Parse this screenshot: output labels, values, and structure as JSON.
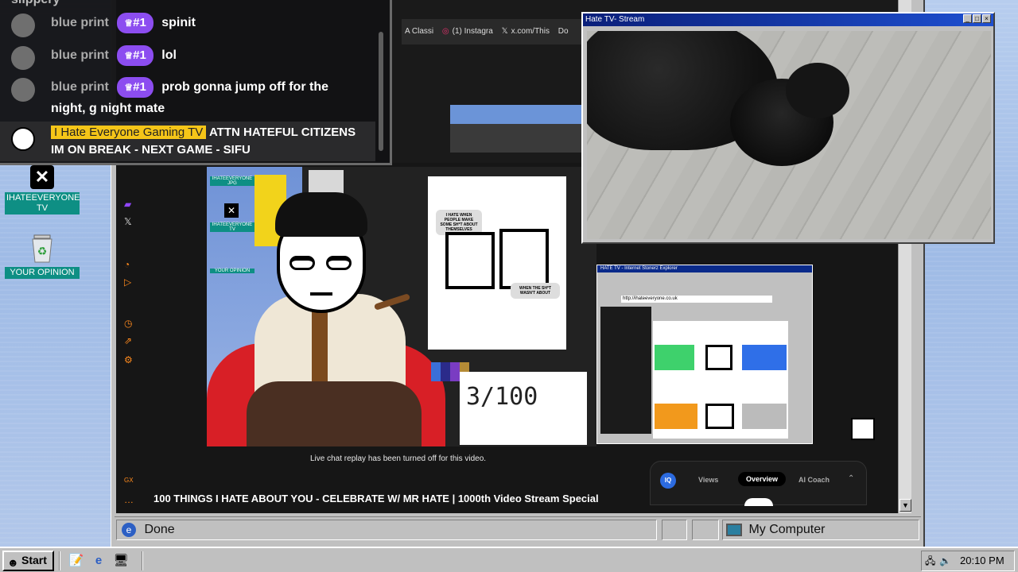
{
  "chat": {
    "partial_top": "slippery",
    "messages": [
      {
        "author": "blue print",
        "badge": "#1",
        "text": "spinit"
      },
      {
        "author": "blue print",
        "badge": "#1",
        "text": "lol"
      },
      {
        "author": "blue print",
        "badge": "#1",
        "text": "prob gonna jump off for the night, g night mate"
      }
    ],
    "pinned": {
      "author": "I Hate Everyone Gaming TV",
      "text": "ATTN HATEFUL CITIZENS IM ON BREAK - NEXT GAME - SIFU"
    }
  },
  "desktop_icons": [
    {
      "label": "IHATEEVERYONE TV",
      "icon": "x-logo-icon"
    },
    {
      "label": "YOUR OPINION",
      "icon": "recycle-bin-icon"
    }
  ],
  "browser_tabs": [
    "A Classi",
    "(1) Instagra",
    "x.com/This",
    "Do"
  ],
  "stream_window": {
    "title": "Hate TV- Stream",
    "buttons": [
      "_",
      "□",
      "×"
    ]
  },
  "video": {
    "mini_icons": [
      "IHATEEVERYONE JPG",
      "IHATEEVERYONE TV",
      "YOUR OPINION"
    ],
    "speech_top": "I HATE WHEN PEOPLE MAKE SOME SH*T ABOUT THEMSELVES",
    "speech_bottom": "WHEN THE SH*T WASN'T ABOUT",
    "counter": "3/100",
    "inner_window_title": "HATE TV - Internet Stonerz Explorer",
    "inner_address": "http://ihateeveryone.co.uk"
  },
  "live_chat_notice": "Live chat replay has been turned off for this video.",
  "video_title": "100 THINGS I HATE ABOUT YOU - CELEBRATE W/ MR HATE | 1000th Video Stream Special",
  "analytics": {
    "logo": "IQ",
    "tabs": [
      "Views",
      "Overview",
      "AI Coach"
    ],
    "active": "Overview"
  },
  "statusbar": {
    "left": "Done",
    "right": "My Computer"
  },
  "taskbar": {
    "start": "Start",
    "clock": "20:10 PM"
  },
  "colors": {
    "badge": "#8c4df0",
    "highlight": "#f5c518",
    "desktop_label": "#0e8f84",
    "accent_orange": "#ff8a1d"
  }
}
